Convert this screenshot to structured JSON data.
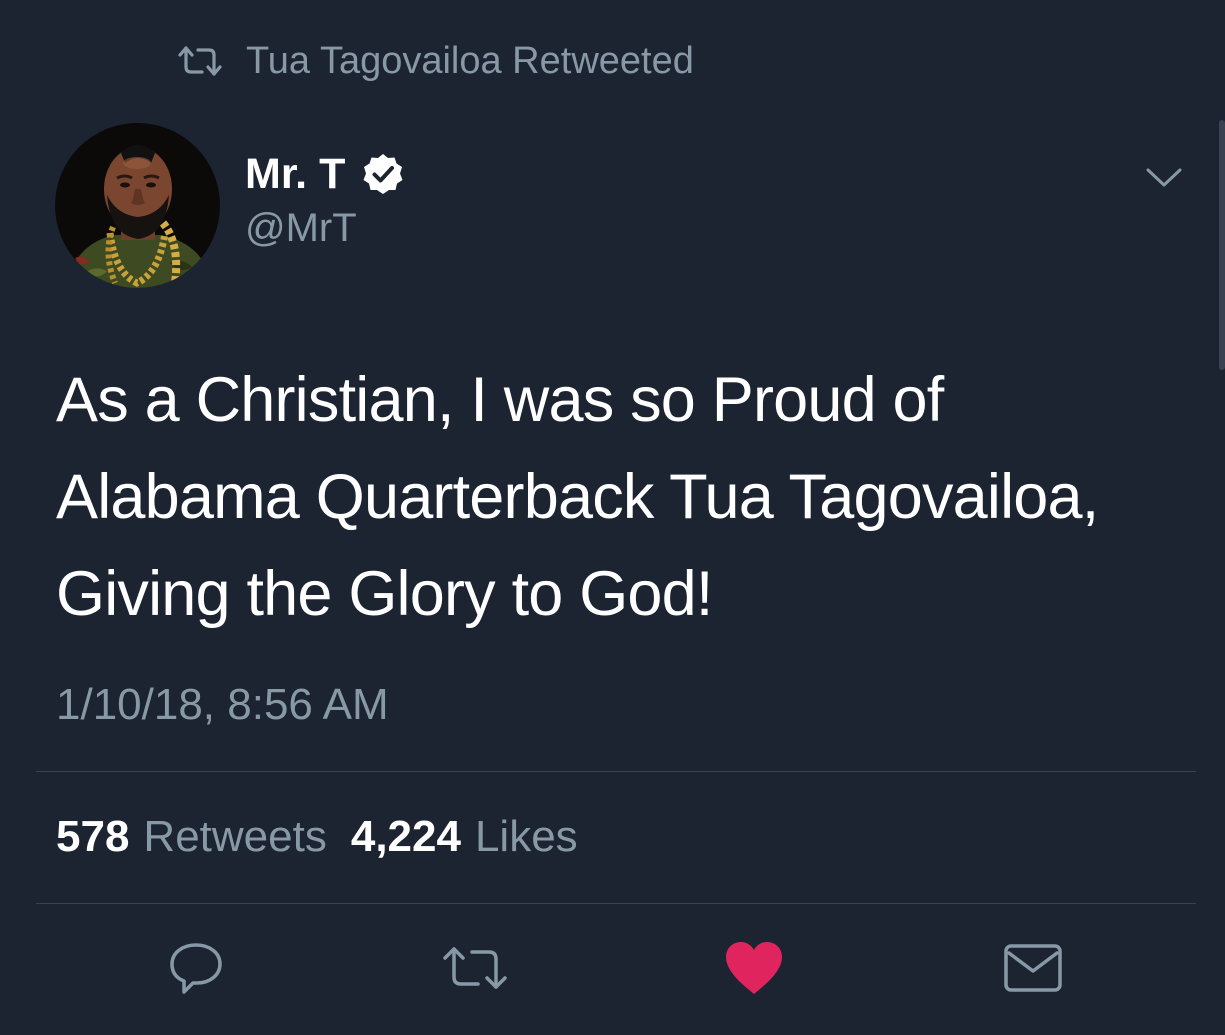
{
  "retweet_banner": {
    "text": "Tua Tagovailoa Retweeted",
    "icon": "retweet-icon"
  },
  "author": {
    "display_name": "Mr. T",
    "handle": "@MrT",
    "verified": true,
    "avatar": "profile-photo"
  },
  "tweet": {
    "lines": [
      "As a Christian, I was so Proud of",
      "Alabama Quarterback Tua Tagovailoa,",
      "Giving the Glory to God!"
    ],
    "timestamp": "1/10/18, 8:56 AM"
  },
  "stats": {
    "retweets_count": "578",
    "retweets_label": "Retweets",
    "likes_count": "4,224",
    "likes_label": "Likes"
  },
  "actions": [
    {
      "name": "reply",
      "icon": "reply-icon"
    },
    {
      "name": "retweet",
      "icon": "retweet-icon"
    },
    {
      "name": "like",
      "icon": "heart-icon",
      "active": true
    },
    {
      "name": "share",
      "icon": "mail-icon"
    }
  ],
  "colors": {
    "background": "#1c2331",
    "secondary_text": "#8899a6",
    "like_active": "#e0245e",
    "verified_badge": "#ffffff"
  }
}
